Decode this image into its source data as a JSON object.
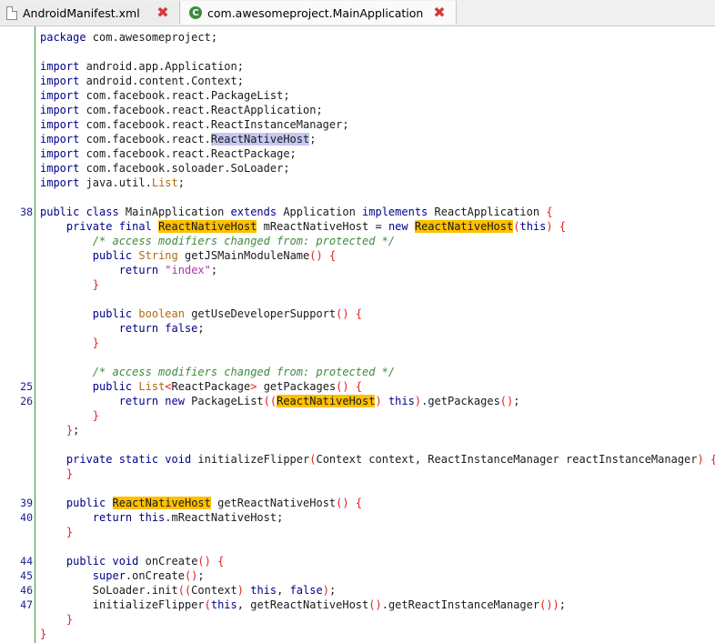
{
  "tabs": [
    {
      "label": "AndroidManifest.xml",
      "icon": "xml-file-icon",
      "close_icon": "close-icon"
    },
    {
      "label": "com.awesomeproject.MainApplication",
      "icon": "java-class-icon",
      "close_icon": "close-icon"
    }
  ],
  "colors": {
    "keyword": "#00008b",
    "type": "#b4690e",
    "comment": "#3f8a3f",
    "string": "#b22fb2",
    "bracket": "#e02020",
    "highlight": "#ffc000",
    "selection": "#c4c8f2",
    "gutter_line": "#2f9b2f"
  },
  "code_lines": [
    {
      "ln": "",
      "tokens": [
        [
          "package",
          "kw"
        ],
        [
          " com.awesomeproject;",
          ""
        ]
      ]
    },
    {
      "ln": "",
      "tokens": []
    },
    {
      "ln": "",
      "tokens": [
        [
          "import",
          "kw"
        ],
        [
          " android.app.Application;",
          ""
        ]
      ]
    },
    {
      "ln": "",
      "tokens": [
        [
          "import",
          "kw"
        ],
        [
          " android.content.Context;",
          ""
        ]
      ]
    },
    {
      "ln": "",
      "tokens": [
        [
          "import",
          "kw"
        ],
        [
          " com.facebook.react.PackageList;",
          ""
        ]
      ]
    },
    {
      "ln": "",
      "tokens": [
        [
          "import",
          "kw"
        ],
        [
          " com.facebook.react.ReactApplication;",
          ""
        ]
      ]
    },
    {
      "ln": "",
      "tokens": [
        [
          "import",
          "kw"
        ],
        [
          " com.facebook.react.ReactInstanceManager;",
          ""
        ]
      ]
    },
    {
      "ln": "",
      "tokens": [
        [
          "import",
          "kw"
        ],
        [
          " com.facebook.react.",
          ""
        ],
        [
          "ReactNativeHost",
          "sel"
        ],
        [
          ";",
          ""
        ]
      ]
    },
    {
      "ln": "",
      "tokens": [
        [
          "import",
          "kw"
        ],
        [
          " com.facebook.react.ReactPackage;",
          ""
        ]
      ]
    },
    {
      "ln": "",
      "tokens": [
        [
          "import",
          "kw"
        ],
        [
          " com.facebook.soloader.SoLoader;",
          ""
        ]
      ]
    },
    {
      "ln": "",
      "tokens": [
        [
          "import",
          "kw"
        ],
        [
          " java.util.",
          ""
        ],
        [
          "List",
          "ty"
        ],
        [
          ";",
          ""
        ]
      ]
    },
    {
      "ln": "",
      "tokens": []
    },
    {
      "ln": "38",
      "tokens": [
        [
          "public class",
          "kw"
        ],
        [
          " MainApplication ",
          ""
        ],
        [
          "extends",
          "kw"
        ],
        [
          " Application ",
          ""
        ],
        [
          "implements",
          "kw"
        ],
        [
          " ReactApplication ",
          ""
        ],
        [
          "{",
          "br"
        ]
      ]
    },
    {
      "ln": "",
      "tokens": [
        [
          "    ",
          ""
        ],
        [
          "private final",
          "kw"
        ],
        [
          " ",
          ""
        ],
        [
          "ReactNativeHost",
          "hl"
        ],
        [
          " mReactNativeHost = ",
          ""
        ],
        [
          "new",
          "kw"
        ],
        [
          " ",
          ""
        ],
        [
          "ReactNativeHost",
          "hl"
        ],
        [
          "(",
          "br"
        ],
        [
          "this",
          "kw"
        ],
        [
          ")",
          "br"
        ],
        [
          " ",
          ""
        ],
        [
          "{",
          "br"
        ]
      ]
    },
    {
      "ln": "",
      "tokens": [
        [
          "        ",
          ""
        ],
        [
          "/* access modifiers changed from: protected */",
          "cm"
        ]
      ]
    },
    {
      "ln": "",
      "tokens": [
        [
          "        ",
          ""
        ],
        [
          "public",
          "kw"
        ],
        [
          " ",
          ""
        ],
        [
          "String",
          "ty"
        ],
        [
          " getJSMainModuleName",
          ""
        ],
        [
          "()",
          "br"
        ],
        [
          " ",
          ""
        ],
        [
          "{",
          "br"
        ]
      ]
    },
    {
      "ln": "",
      "tokens": [
        [
          "            ",
          ""
        ],
        [
          "return",
          "kw"
        ],
        [
          " ",
          ""
        ],
        [
          "\"index\"",
          "st"
        ],
        [
          ";",
          ""
        ]
      ]
    },
    {
      "ln": "",
      "tokens": [
        [
          "        ",
          ""
        ],
        [
          "}",
          "br"
        ]
      ]
    },
    {
      "ln": "",
      "tokens": []
    },
    {
      "ln": "",
      "tokens": [
        [
          "        ",
          ""
        ],
        [
          "public",
          "kw"
        ],
        [
          " ",
          ""
        ],
        [
          "boolean",
          "ty"
        ],
        [
          " getUseDeveloperSupport",
          ""
        ],
        [
          "()",
          "br"
        ],
        [
          " ",
          ""
        ],
        [
          "{",
          "br"
        ]
      ]
    },
    {
      "ln": "",
      "tokens": [
        [
          "            ",
          ""
        ],
        [
          "return false",
          "kw"
        ],
        [
          ";",
          ""
        ]
      ]
    },
    {
      "ln": "",
      "tokens": [
        [
          "        ",
          ""
        ],
        [
          "}",
          "br"
        ]
      ]
    },
    {
      "ln": "",
      "tokens": []
    },
    {
      "ln": "",
      "tokens": [
        [
          "        ",
          ""
        ],
        [
          "/* access modifiers changed from: protected */",
          "cm"
        ]
      ]
    },
    {
      "ln": "25",
      "tokens": [
        [
          "        ",
          ""
        ],
        [
          "public",
          "kw"
        ],
        [
          " ",
          ""
        ],
        [
          "List",
          "ty"
        ],
        [
          "<",
          "br"
        ],
        [
          "ReactPackage",
          ""
        ],
        [
          ">",
          "br"
        ],
        [
          " getPackages",
          ""
        ],
        [
          "()",
          "br"
        ],
        [
          " ",
          ""
        ],
        [
          "{",
          "br"
        ]
      ]
    },
    {
      "ln": "26",
      "tokens": [
        [
          "            ",
          ""
        ],
        [
          "return new",
          "kw"
        ],
        [
          " PackageList",
          ""
        ],
        [
          "((",
          "br"
        ],
        [
          "ReactNativeHost",
          "hl"
        ],
        [
          ")",
          "br"
        ],
        [
          " ",
          ""
        ],
        [
          "this",
          "kw"
        ],
        [
          ")",
          "br"
        ],
        [
          ".getPackages",
          ""
        ],
        [
          "()",
          "br"
        ],
        [
          ";",
          ""
        ]
      ]
    },
    {
      "ln": "",
      "tokens": [
        [
          "        ",
          ""
        ],
        [
          "}",
          "br"
        ]
      ]
    },
    {
      "ln": "",
      "tokens": [
        [
          "    ",
          ""
        ],
        [
          "}",
          "br"
        ],
        [
          ";",
          ""
        ]
      ]
    },
    {
      "ln": "",
      "tokens": []
    },
    {
      "ln": "",
      "tokens": [
        [
          "    ",
          ""
        ],
        [
          "private static void",
          "kw"
        ],
        [
          " initializeFlipper",
          ""
        ],
        [
          "(",
          "br"
        ],
        [
          "Context context, ReactInstanceManager reactInstanceManager",
          ""
        ],
        [
          ")",
          "br"
        ],
        [
          " ",
          ""
        ],
        [
          "{",
          "br"
        ]
      ]
    },
    {
      "ln": "",
      "tokens": [
        [
          "    ",
          ""
        ],
        [
          "}",
          "br"
        ]
      ]
    },
    {
      "ln": "",
      "tokens": []
    },
    {
      "ln": "39",
      "tokens": [
        [
          "    ",
          ""
        ],
        [
          "public",
          "kw"
        ],
        [
          " ",
          ""
        ],
        [
          "ReactNativeHost",
          "hl"
        ],
        [
          " getReactNativeHost",
          ""
        ],
        [
          "()",
          "br"
        ],
        [
          " ",
          ""
        ],
        [
          "{",
          "br"
        ]
      ]
    },
    {
      "ln": "40",
      "tokens": [
        [
          "        ",
          ""
        ],
        [
          "return this",
          "kw"
        ],
        [
          ".mReactNativeHost;",
          ""
        ]
      ]
    },
    {
      "ln": "",
      "tokens": [
        [
          "    ",
          ""
        ],
        [
          "}",
          "br"
        ]
      ]
    },
    {
      "ln": "",
      "tokens": []
    },
    {
      "ln": "44",
      "tokens": [
        [
          "    ",
          ""
        ],
        [
          "public void",
          "kw"
        ],
        [
          " onCreate",
          ""
        ],
        [
          "()",
          "br"
        ],
        [
          " ",
          ""
        ],
        [
          "{",
          "br"
        ]
      ]
    },
    {
      "ln": "45",
      "tokens": [
        [
          "        ",
          ""
        ],
        [
          "super",
          "kw"
        ],
        [
          ".onCreate",
          ""
        ],
        [
          "()",
          "br"
        ],
        [
          ";",
          ""
        ]
      ]
    },
    {
      "ln": "46",
      "tokens": [
        [
          "        ",
          ""
        ],
        [
          "SoLoader.init",
          ""
        ],
        [
          "((",
          "br"
        ],
        [
          "Context",
          ""
        ],
        [
          ")",
          "br"
        ],
        [
          " ",
          ""
        ],
        [
          "this",
          "kw"
        ],
        [
          ", ",
          ""
        ],
        [
          "false",
          "kw"
        ],
        [
          ")",
          "br"
        ],
        [
          ";",
          ""
        ]
      ]
    },
    {
      "ln": "47",
      "tokens": [
        [
          "        ",
          ""
        ],
        [
          "initializeFlipper",
          ""
        ],
        [
          "(",
          "br"
        ],
        [
          "this",
          "kw"
        ],
        [
          ", getReactNativeHost",
          ""
        ],
        [
          "()",
          "br"
        ],
        [
          ".getReactInstanceManager",
          ""
        ],
        [
          "())",
          "br"
        ],
        [
          ";",
          ""
        ]
      ]
    },
    {
      "ln": "",
      "tokens": [
        [
          "    ",
          ""
        ],
        [
          "}",
          "br"
        ]
      ]
    },
    {
      "ln": "",
      "tokens": [
        [
          "}",
          "br"
        ]
      ]
    }
  ]
}
